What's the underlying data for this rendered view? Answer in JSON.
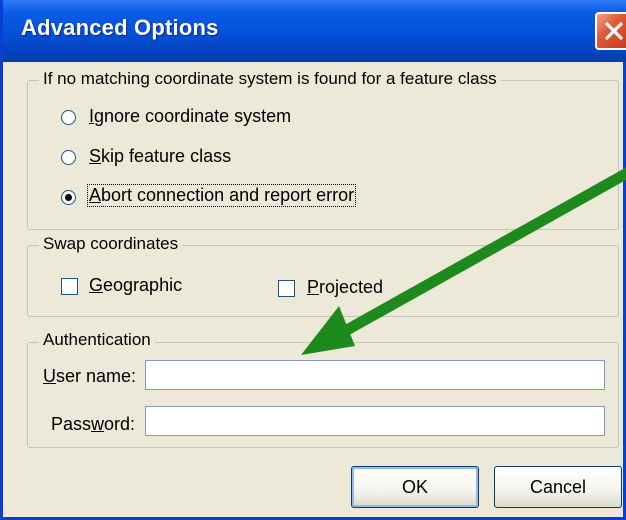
{
  "window": {
    "title": "Advanced Options"
  },
  "coordinate_group": {
    "legend": "If no matching coordinate system is found for a feature class",
    "options": [
      {
        "label": "Ignore coordinate system",
        "selected": false
      },
      {
        "label": "Skip feature class",
        "selected": false
      },
      {
        "label": "Abort connection and report error",
        "selected": true
      }
    ]
  },
  "swap_group": {
    "legend": "Swap coordinates",
    "geographic": {
      "label": "Geographic",
      "checked": false
    },
    "projected": {
      "label": "Projected",
      "checked": false
    }
  },
  "auth_group": {
    "legend": "Authentication",
    "user_label": "User name:",
    "user_value": "",
    "password_label": "Password:",
    "password_value": ""
  },
  "buttons": {
    "ok": "OK",
    "cancel": "Cancel"
  },
  "annotation": {
    "arrow_color": "#1e8a1e"
  }
}
